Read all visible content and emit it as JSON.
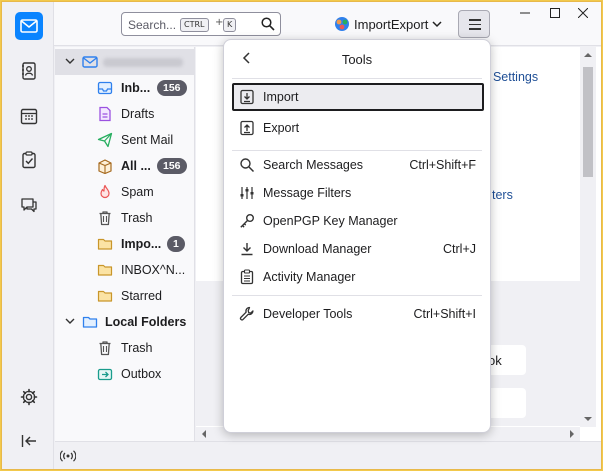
{
  "search": {
    "placeholder": "Search...",
    "key_ctrl": "CTRL",
    "key_plus": "+",
    "key_k": "K"
  },
  "account_button": {
    "label": "ImportExport"
  },
  "folders": [
    {
      "label": "Inb...",
      "badge": "156",
      "bold": true,
      "icon": "inbox-icon"
    },
    {
      "label": "Drafts",
      "icon": "drafts-icon"
    },
    {
      "label": "Sent Mail",
      "icon": "sent-icon"
    },
    {
      "label": "All ...",
      "badge": "156",
      "bold": true,
      "icon": "archive-icon"
    },
    {
      "label": "Spam",
      "icon": "spam-icon"
    },
    {
      "label": "Trash",
      "icon": "trash-icon"
    },
    {
      "label": "Impo...",
      "badge": "1",
      "bold": true,
      "icon": "folder-icon"
    },
    {
      "label": "INBOX^N...",
      "icon": "folder-icon"
    },
    {
      "label": "Starred",
      "icon": "folder-icon"
    }
  ],
  "local_folders": {
    "label": "Local Folders",
    "children": [
      {
        "label": "Trash",
        "icon": "trash-icon"
      },
      {
        "label": "Outbox",
        "icon": "outbox-icon"
      }
    ]
  },
  "content": {
    "partial_settings": "t Settings",
    "partial_filters": "ters",
    "partial_ok": "ok"
  },
  "menu": {
    "title": "Tools",
    "items": [
      {
        "label": "Import",
        "shortcut": "",
        "icon": "import-icon",
        "focused": true
      },
      {
        "label": "Export",
        "shortcut": "",
        "icon": "export-icon"
      },
      {
        "label": "Search Messages",
        "shortcut": "Ctrl+Shift+F",
        "icon": "search-icon"
      },
      {
        "label": "Message Filters",
        "shortcut": "",
        "icon": "filter-icon"
      },
      {
        "label": "OpenPGP Key Manager",
        "shortcut": "",
        "icon": "key-icon"
      },
      {
        "label": "Download Manager",
        "shortcut": "Ctrl+J",
        "icon": "download-icon"
      },
      {
        "label": "Activity Manager",
        "shortcut": "",
        "icon": "activity-icon"
      },
      {
        "label": "Developer Tools",
        "shortcut": "Ctrl+Shift+I",
        "icon": "wrench-icon"
      }
    ]
  },
  "colors": {
    "accent": "#0a84ff",
    "frame": "#f2c94c",
    "badge": "#5b5b66",
    "link": "#1f4f96"
  }
}
